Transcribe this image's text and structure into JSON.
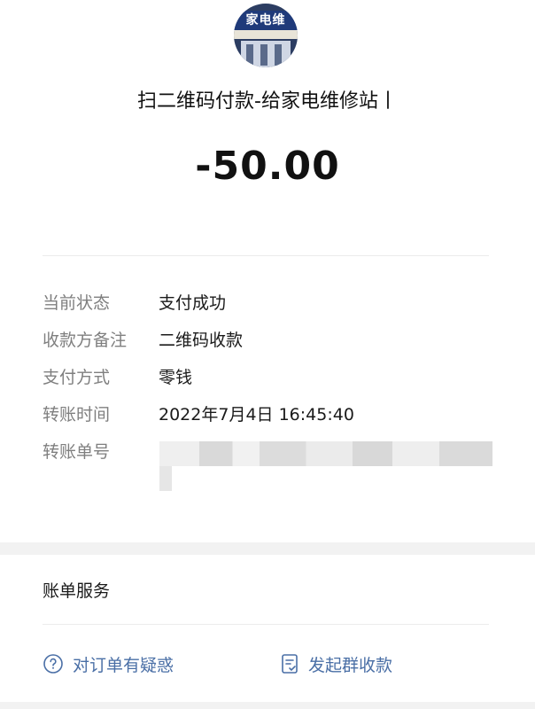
{
  "merchant": {
    "sign_text": "家电维",
    "title": "扫二维码付款-给家电维修站丨"
  },
  "amount": "-50.00",
  "details": [
    {
      "label": "当前状态",
      "value": "支付成功"
    },
    {
      "label": "收款方备注",
      "value": "二维码收款"
    },
    {
      "label": "支付方式",
      "value": "零钱"
    },
    {
      "label": "转账时间",
      "value": "2022年7月4日 16:45:40"
    },
    {
      "label": "转账单号",
      "value": ""
    }
  ],
  "services": {
    "title": "账单服务",
    "question_label": "对订单有疑惑",
    "group_collect_label": "发起群收款"
  },
  "colors": {
    "link": "#4a6fa6",
    "label": "#7f7f7f"
  },
  "icons": {
    "question": "question-circle-icon",
    "group_collect": "receipt-icon"
  }
}
